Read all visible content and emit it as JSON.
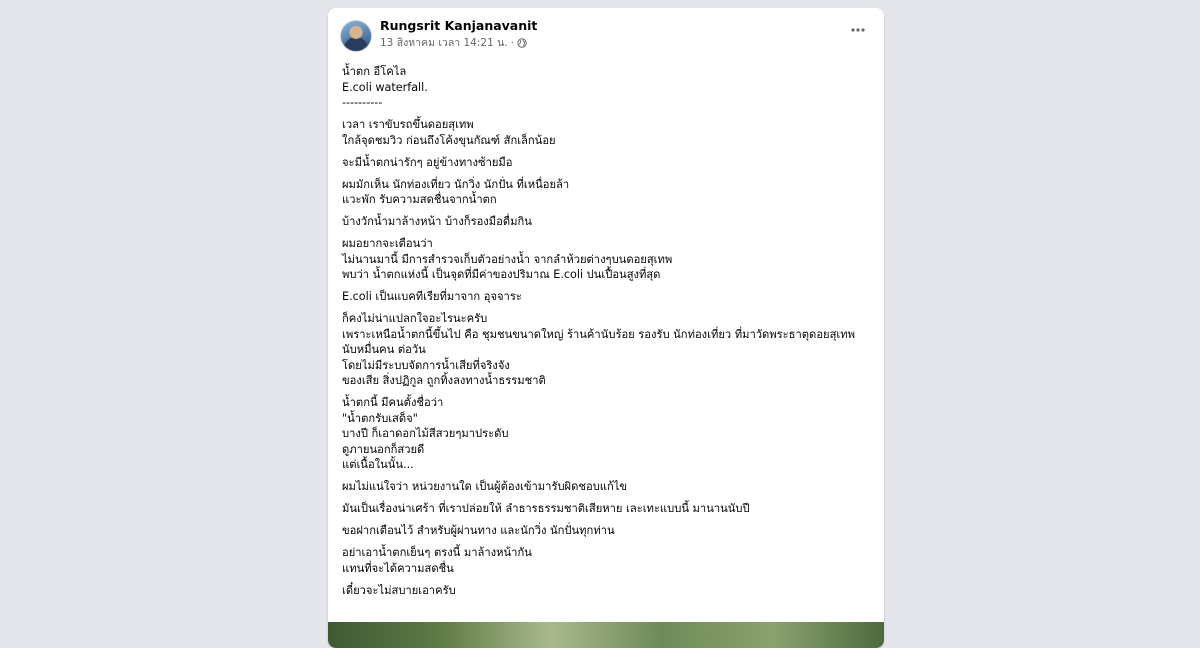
{
  "post": {
    "author": "Rungsrit Kanjanavanit",
    "timestamp": "13 สิงหาคม เวลา 14:21 น.",
    "separator": "·",
    "privacy_icon": "globe-icon",
    "more_icon": "more-horizontal-icon",
    "paragraphs": [
      [
        "น้ำตก อีโคไล",
        "E.coli waterfall.",
        "----------"
      ],
      [
        "เวลา เราขับรถขึ้นดอยสุเทพ",
        "ใกล้จุดชมวิว ก่อนถึงโค้งขุนกัณฑ์ สักเล็กน้อย"
      ],
      [
        "จะมีน้ำตกน่ารักๆ อยู่ข้างทางซ้ายมือ"
      ],
      [
        "ผมมักเห็น นักท่องเที่ยว นักวิ่ง นักปั่น ที่เหนื่อยล้า",
        "แวะพัก รับความสดชื่นจากน้ำตก"
      ],
      [
        "บ้างวักน้ำมาล้างหน้า บ้างก็รองมือดื่มกิน"
      ],
      [
        "ผมอยากจะเตือนว่า",
        "ไม่นานมานี้ มีการสำรวจเก็บตัวอย่างน้ำ จากลำห้วยต่างๆบนดอยสุเทพ",
        "พบว่า น้ำตกแห่งนี้ เป็นจุดที่มีค่าของปริมาณ E.coli ปนเปื้อนสูงที่สุด"
      ],
      [
        "E.coli เป็นแบคทีเรียที่มาจาก อุจจาระ"
      ],
      [
        "ก็คงไม่น่าแปลกใจอะไรนะครับ",
        "เพราะเหนือน้ำตกนี้ขึ้นไป คือ ชุมชนขนาดใหญ่ ร้านค้านับร้อย รองรับ นักท่องเที่ยว ที่มาวัดพระธาตุดอยสุเทพ",
        "นับหมื่นคน ต่อวัน",
        "โดยไม่มีระบบจัดการน้ำเสียที่จริงจัง",
        "ของเสีย สิ่งปฏิกูล ถูกทิ้งลงทางน้ำธรรมชาติ"
      ],
      [
        "น้ำตกนี้ มีคนตั้งชื่อว่า",
        "\"น้ำตกรับเสด็จ\"",
        "บางปี ก็เอาดอกไม้สีสวยๆมาประดับ",
        "ดูภายนอกก็สวยดี",
        "แต่เนื้อในนั้น..."
      ],
      [
        "ผมไม่แน่ใจว่า หน่วยงานใด เป็นผู้ต้องเข้ามารับผิดชอบแก้ไข"
      ],
      [
        "มันเป็นเรื่องน่าเศร้า ที่เราปล่อยให้ ลำธารธรรมชาติเสียหาย เละเทะแบบนี้ มานานนับปี"
      ],
      [
        "ขอฝากเตือนไว้ สำหรับผู้ผ่านทาง และนักวิ่ง นักปั่นทุกท่าน"
      ],
      [
        "อย่าเอาน้ำตกเย็นๆ ตรงนี้ มาล้างหน้ากัน",
        "แทนที่จะได้ความสดชื่น"
      ],
      [
        "เดี๋ยวจะไม่สบายเอาครับ"
      ]
    ]
  }
}
